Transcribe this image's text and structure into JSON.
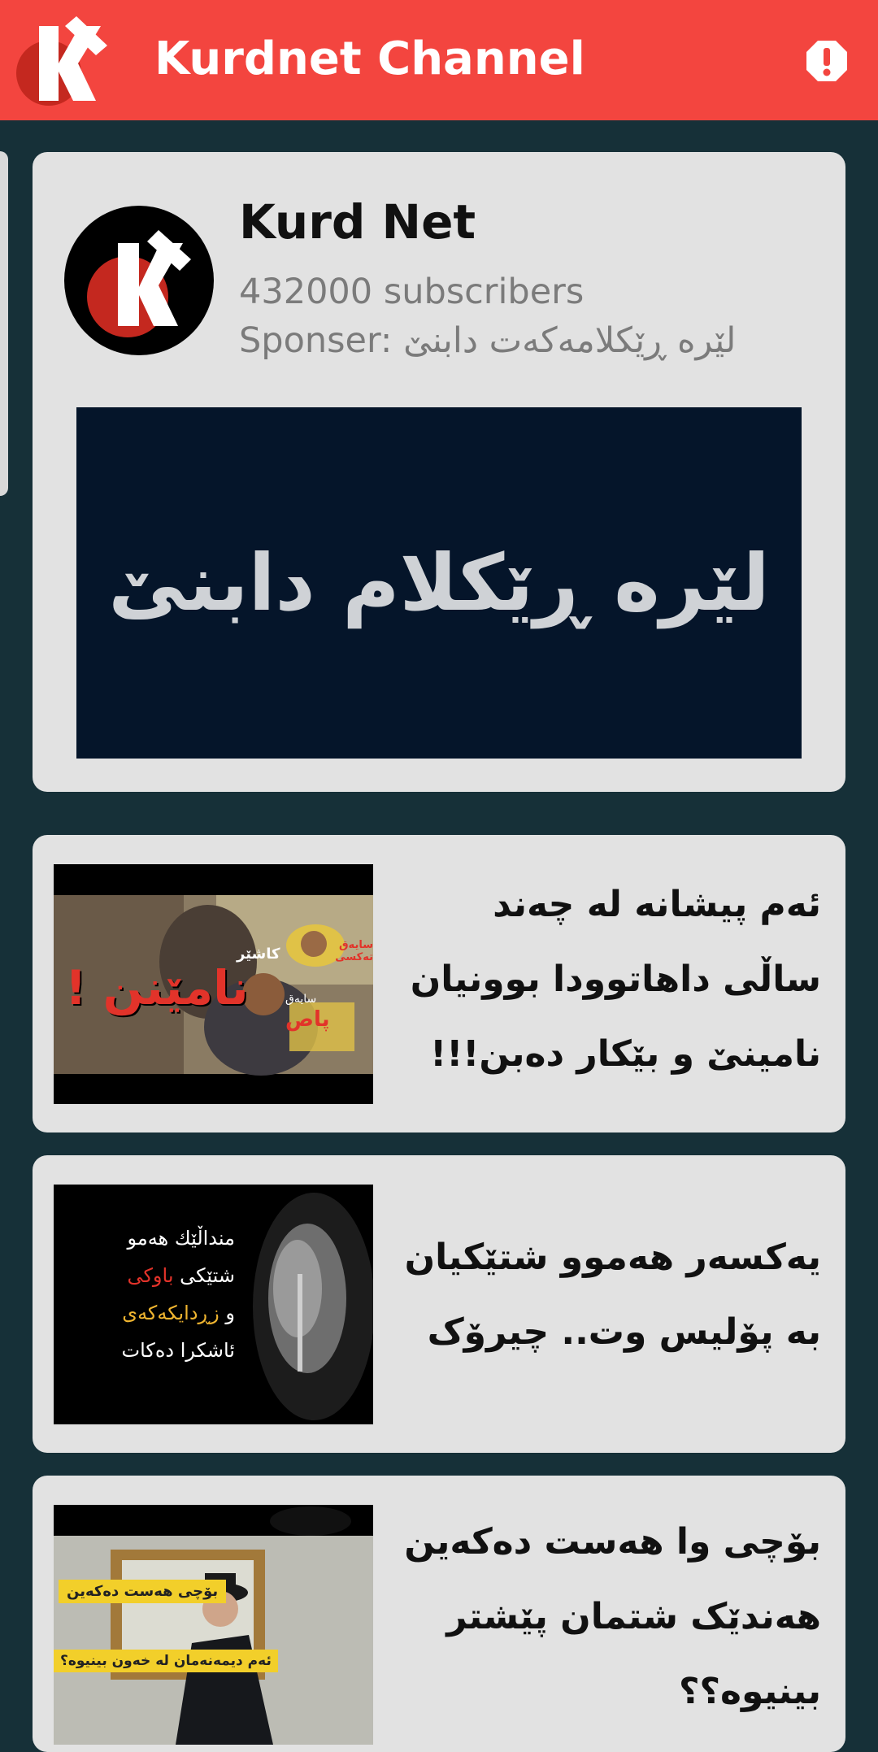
{
  "app": {
    "title": "Kurdnet Channel",
    "brand_color": "#f3453f",
    "background_color": "#163038",
    "alert_icon": "alert-octagon-icon"
  },
  "channel": {
    "name": "Kurd Net",
    "subscribers": "432000 subscribers",
    "sponsor": "Sponser: لێرە ڕێکلامەکەت دابنێ",
    "banner_text": "لێرە ڕێکلام دابنێ"
  },
  "videos": [
    {
      "title": "ئەم پیشانە لە چەند ساڵی داهاتوودا بوونیان نامینێ و بێکار دەبن!!!",
      "thumbnail": {
        "big_word": "نامێنن !",
        "tag_left": "کاشێر",
        "tag_top": "سایەق تەکسی",
        "tag_bottom_small": "سایەق",
        "tag_bottom": "پاص"
      }
    },
    {
      "title": "یەکسەر هەموو شتێکیان بە پۆلیس وت.. چیرۆک",
      "thumbnail": {
        "line1": "منداڵێك هەمو",
        "line2_a": "شتێکی",
        "line2_b": "باوکی",
        "line3_a": "و",
        "line3_b": "زڕدایکەکەی",
        "line4": "ئاشکرا دەکات"
      }
    },
    {
      "title": "بۆچی وا هەست دەکەین هەندێک شتمان پێشتر بینیوە؟؟",
      "thumbnail": {
        "tag1": "بۆچی هەست دەکەین",
        "tag2": "ئەم دیمەنەمان لە خەون بینیوە؟"
      }
    }
  ]
}
